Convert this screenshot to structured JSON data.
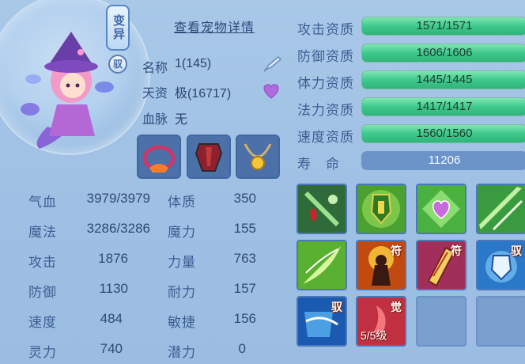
{
  "pet": {
    "variant_badge": "变异",
    "tame_badge": "驭",
    "detail_link": "查看宠物详情",
    "name_label": "名称",
    "name_value": "1(145)",
    "talent_label": "天资",
    "talent_value": "极(16717)",
    "bloodline_label": "血脉",
    "bloodline_value": "无"
  },
  "stats_left": [
    {
      "label": "气血",
      "value": "3979/3979"
    },
    {
      "label": "魔法",
      "value": "3286/3286"
    },
    {
      "label": "攻击",
      "value": "1876"
    },
    {
      "label": "防御",
      "value": "1130"
    },
    {
      "label": "速度",
      "value": "484"
    },
    {
      "label": "灵力",
      "value": "740"
    }
  ],
  "stats_right": [
    {
      "label": "体质",
      "value": "350"
    },
    {
      "label": "魔力",
      "value": "155"
    },
    {
      "label": "力量",
      "value": "763"
    },
    {
      "label": "耐力",
      "value": "157"
    },
    {
      "label": "敏捷",
      "value": "156"
    },
    {
      "label": "潜力",
      "value": "0"
    }
  ],
  "aptitudes": [
    {
      "label": "攻击资质",
      "value": "1571/1571"
    },
    {
      "label": "防御资质",
      "value": "1606/1606"
    },
    {
      "label": "体力资质",
      "value": "1445/1445"
    },
    {
      "label": "法力资质",
      "value": "1417/1417"
    },
    {
      "label": "速度资质",
      "value": "1560/1560"
    }
  ],
  "lifespan": {
    "label": "寿　命",
    "value": "11206"
  },
  "skills": {
    "tag_fu": "符",
    "tag_yu": "驭",
    "tag_jue": "觉",
    "awaken_level": "5/5级"
  },
  "colors": {
    "aptitude_bar": "#3fc98c",
    "panel_bg": "#a9c8e8",
    "text": "#3d5e93"
  }
}
